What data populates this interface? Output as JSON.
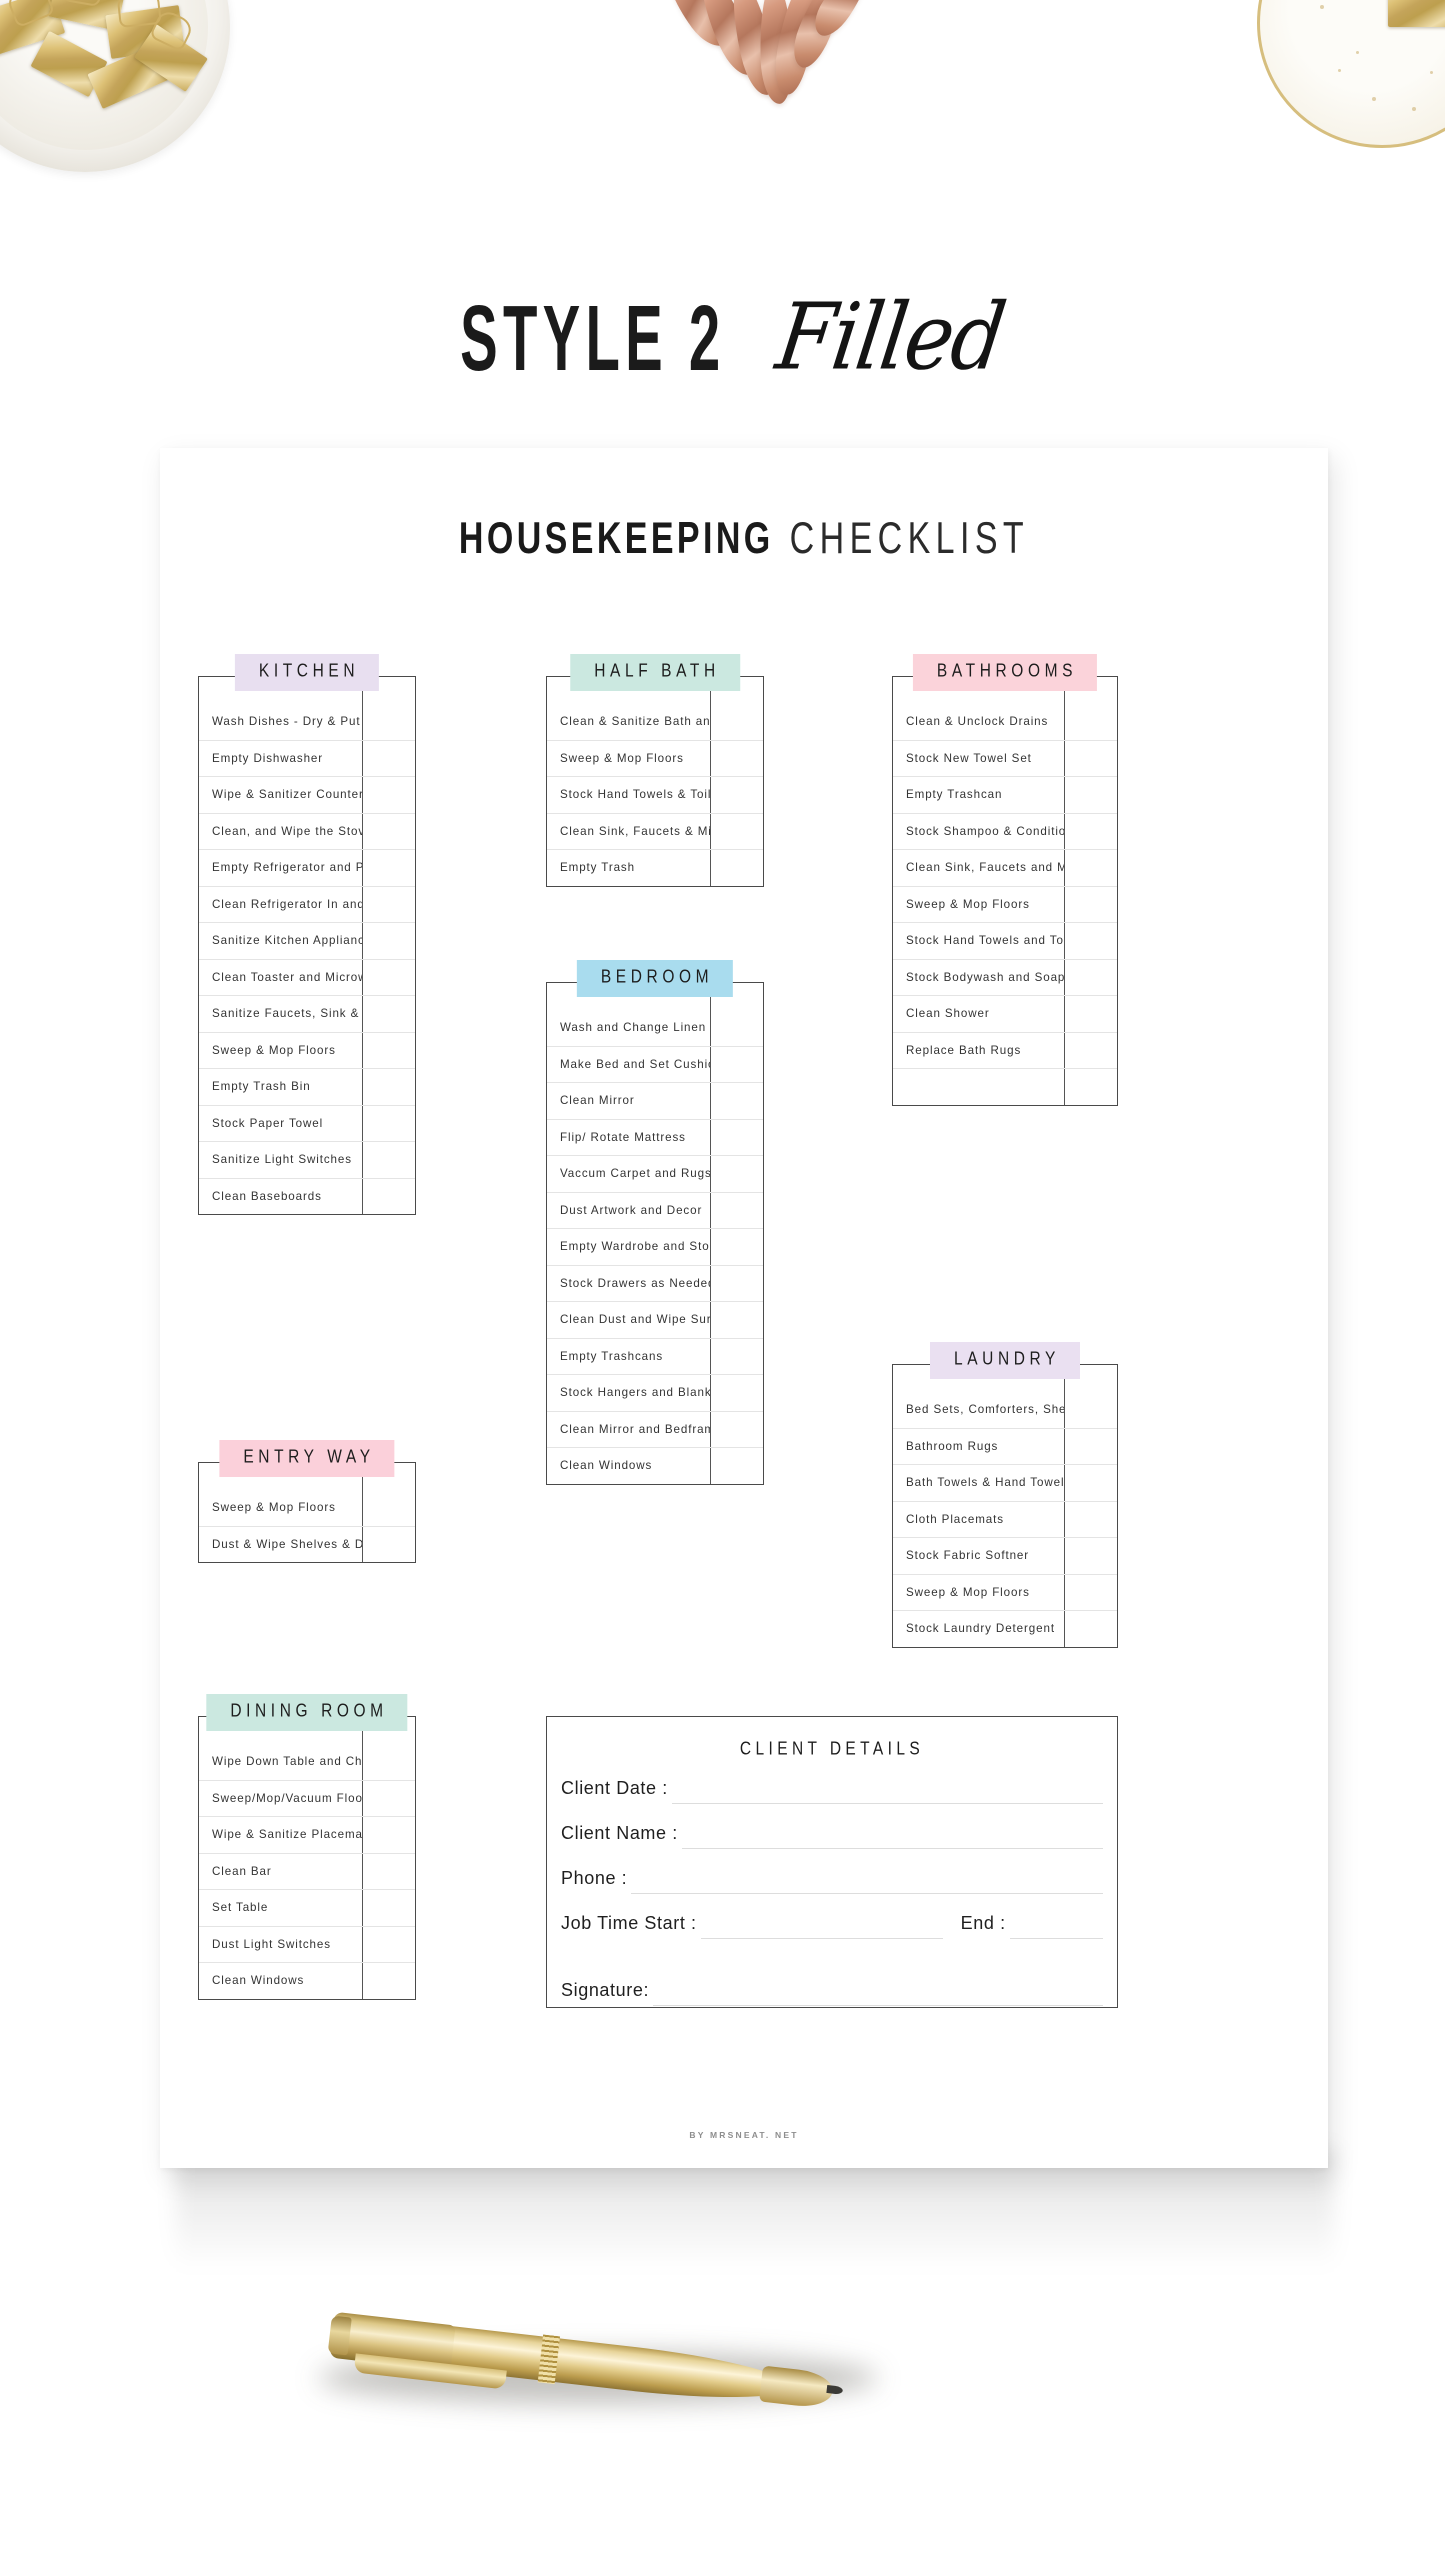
{
  "style_header": {
    "block_word": "STYLE 2",
    "script_word": "Filled"
  },
  "document": {
    "title_bold": "HOUSEKEEPING",
    "title_light": "CHECKLIST",
    "credit": "BY  MRSNEAT. NET"
  },
  "colors": {
    "lavender": "#e8dff0",
    "mint": "#cbe8e0",
    "pink": "#fbd3da",
    "blue": "#a9dcee",
    "entry_pink": "#fbd0da",
    "laundry_lavender": "#eae0f1",
    "border": "#4a4a4a",
    "row_divider": "#e4e4e4",
    "text": "#333333"
  },
  "sections": [
    {
      "id": "kitchen",
      "title": "KITCHEN",
      "color": "#e8dff0",
      "items": [
        "Wash Dishes - Dry & Put Away",
        "Empty Dishwasher",
        "Wipe & Sanitizer Counters",
        "Clean, and Wipe the Stovetop",
        "Empty Refrigerator and Pantry",
        "Clean Refrigerator In and Out",
        "Sanitize Kitchen Appliances",
        "Clean Toaster and Microwave",
        "Sanitize Faucets, Sink & Handles",
        "Sweep & Mop Floors",
        "Empty Trash Bin",
        "Stock Paper Towel",
        "Sanitize Light Switches",
        "Clean Baseboards"
      ]
    },
    {
      "id": "half-bath",
      "title": "HALF BATH",
      "color": "#cbe8e0",
      "items": [
        "Clean & Sanitize Bath and Toilet",
        "Sweep & Mop Floors",
        "Stock Hand Towels & Toilet Roll",
        "Clean Sink, Faucets & Mirror",
        "Empty Trash"
      ]
    },
    {
      "id": "bathrooms",
      "title": "BATHROOMS",
      "color": "#fbd3da",
      "items": [
        "Clean & Unclock Drains",
        "Stock New Towel Set",
        "Empty Trashcan",
        "Stock Shampoo & Conditioner",
        "Clean Sink, Faucets and Mirror",
        "Sweep & Mop Floors",
        "Stock Hand Towels and Toilet Roll",
        "Stock Bodywash and Soap",
        "Clean Shower",
        "Replace Bath Rugs",
        ""
      ]
    },
    {
      "id": "bedroom",
      "title": "BEDROOM",
      "color": "#a9dcee",
      "items": [
        "Wash and Change Linen",
        "Make Bed and Set Cushions",
        "Clean Mirror",
        "Flip/ Rotate Mattress",
        "Vaccum Carpet and Rugs",
        "Dust Artwork and Decor",
        "Empty Wardrobe and Storage",
        "Stock Drawers as Needed",
        "Clean Dust and Wipe Surfaces",
        "Empty Trashcans",
        "Stock Hangers and Blankets",
        "Clean Mirror and Bedframe",
        "Clean Windows"
      ]
    },
    {
      "id": "entry-way",
      "title": "ENTRY WAY",
      "color": "#fbd0da",
      "items": [
        "Sweep & Mop Floors",
        "Dust & Wipe Shelves & Door"
      ]
    },
    {
      "id": "laundry",
      "title": "LAUNDRY",
      "color": "#eae0f1",
      "items": [
        "Bed Sets, Comforters, Sheets",
        "Bathroom Rugs",
        "Bath Towels & Hand Towels",
        "Cloth Placemats",
        "Stock Fabric Softner",
        "Sweep & Mop Floors",
        "Stock Laundry Detergent"
      ]
    },
    {
      "id": "dining-room",
      "title": "DINING ROOM",
      "color": "#cbe8e0",
      "items": [
        "Wipe Down Table and Chairs",
        "Sweep/Mop/Vacuum Floors",
        "Wipe & Sanitize Placemats",
        "Clean Bar",
        "Set Table",
        "Dust Light Switches",
        "Clean Windows"
      ]
    }
  ],
  "client_details": {
    "title": "CLIENT DETAILS",
    "fields": [
      {
        "label": "Client Date :",
        "type": "full"
      },
      {
        "label": "Client Name :",
        "type": "full"
      },
      {
        "label": "Phone :",
        "type": "full"
      },
      {
        "label": "Job Time Start :",
        "type": "split",
        "second_label": "End :"
      },
      {
        "label": "Signature:",
        "type": "full"
      }
    ]
  }
}
